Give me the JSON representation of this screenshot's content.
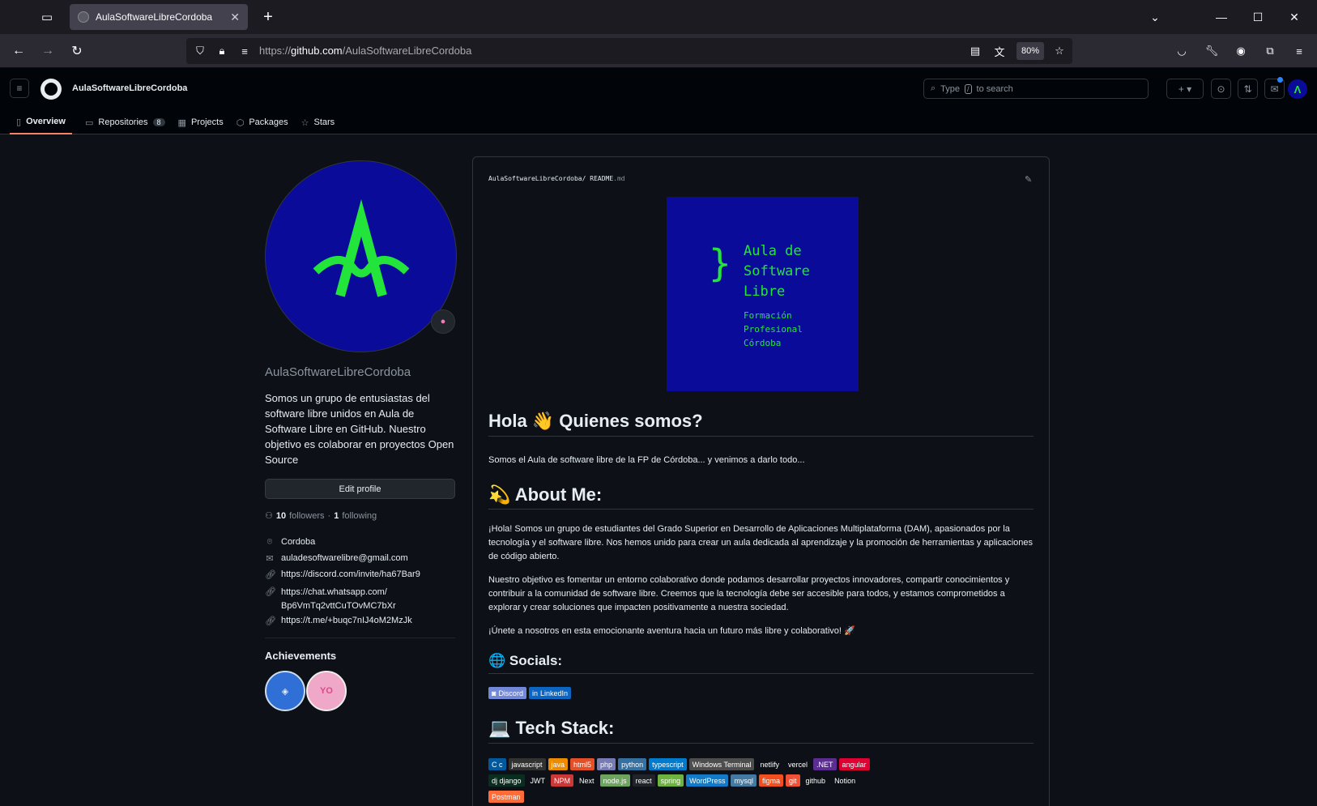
{
  "browser": {
    "tab_title": "AulaSoftwareLibreCordoba",
    "url_prefix": "https://",
    "url_host": "github.com",
    "url_path": "/AulaSoftwareLibreCordoba",
    "zoom": "80%"
  },
  "header": {
    "org_name": "AulaSoftwareLibreCordoba",
    "search_prefix": "Type",
    "search_key": "/",
    "search_suffix": "to search"
  },
  "tabs": [
    {
      "label": "Overview",
      "icon": "book-icon"
    },
    {
      "label": "Repositories",
      "icon": "repo-icon",
      "count": "8"
    },
    {
      "label": "Projects",
      "icon": "table-icon"
    },
    {
      "label": "Packages",
      "icon": "package-icon"
    },
    {
      "label": "Stars",
      "icon": "star-icon"
    }
  ],
  "profile": {
    "avatar_letter": "A",
    "username": "AulaSoftwareLibreCordoba",
    "bio": "Somos un grupo de entusiastas del software libre unidos en Aula de Software Libre en GitHub. Nuestro objetivo es colaborar en proyectos Open Source",
    "edit_label": "Edit profile",
    "followers_count": "10",
    "followers_label": "followers",
    "dot": "·",
    "following_count": "1",
    "following_label": "following",
    "location": "Cordoba",
    "email": "auladesoftwarelibre@gmail.com",
    "link1": "https://discord.com/invite/ha67Bar9",
    "link2_line1": "https://chat.whatsapp.com/",
    "link2_line2": "Bp6VmTq2vttCuTOvMC7bXr",
    "link3": "https://t.me/+buqc7nIJ4oM2MzJk",
    "achievements_title": "Achievements"
  },
  "readme": {
    "path_owner": "AulaSoftwareLibreCordoba",
    "path_sep": "/",
    "path_file": "README",
    "path_ext": ".md",
    "logo_title_1": "Aula de",
    "logo_title_2": "Software",
    "logo_title_3": "Libre",
    "logo_sub_1": "Formación",
    "logo_sub_2": "Profesional",
    "logo_sub_3": "Córdoba",
    "h_hola": "Hola 👋 Quienes somos?",
    "p_intro": "Somos el Aula de software libre de la FP de Córdoba... y venimos a darlo todo...",
    "h_about": "💫 About Me:",
    "p_about1": "¡Hola! Somos un grupo de estudiantes del Grado Superior en Desarrollo de Aplicaciones Multiplataforma (DAM), apasionados por la tecnología y el software libre. Nos hemos unido para crear un aula dedicada al aprendizaje y la promoción de herramientas y aplicaciones de código abierto.",
    "p_about2": "Nuestro objetivo es fomentar un entorno colaborativo donde podamos desarrollar proyectos innovadores, compartir conocimientos y contribuir a la comunidad de software libre. Creemos que la tecnología debe ser accesible para todos, y estamos comprometidos a explorar y crear soluciones que impacten positivamente a nuestra sociedad.",
    "p_about3": "¡Únete a nosotros en esta emocionante aventura hacia un futuro más libre y colaborativo! 🚀",
    "h_socials": "🌐 Socials:",
    "socials": [
      {
        "label": "Discord",
        "color": "#7289da"
      },
      {
        "label": "LinkedIn",
        "color": "#0a66c2"
      }
    ],
    "h_tech": "💻 Tech Stack:",
    "tech_row1": [
      {
        "label": "C  c",
        "color": "#00599c"
      },
      {
        "label": "javascript",
        "color": "#323330"
      },
      {
        "label": "java",
        "color": "#ed8b00"
      },
      {
        "label": "html5",
        "color": "#e34f26"
      },
      {
        "label": "php",
        "color": "#777bb4"
      },
      {
        "label": "python",
        "color": "#3670a0"
      },
      {
        "label": "typescript",
        "color": "#007acc"
      },
      {
        "label": "Windows Terminal",
        "color": "#4d4d4d"
      },
      {
        "label": "netlify",
        "color": "#0d1117"
      },
      {
        "label": "vercel",
        "color": "#0d1117"
      },
      {
        "label": ".NET",
        "color": "#5c2d91"
      },
      {
        "label": "angular",
        "color": "#dd0031"
      }
    ],
    "tech_row2": [
      {
        "label": "dj  django",
        "color": "#092e20"
      },
      {
        "label": "JWT",
        "color": "#0d1117"
      },
      {
        "label": "NPM",
        "color": "#cb3837"
      },
      {
        "label": "Next",
        "color": "#0d1117"
      },
      {
        "label": "node.js",
        "color": "#6da55f"
      },
      {
        "label": "react",
        "color": "#20232a"
      },
      {
        "label": "spring",
        "color": "#6db33f"
      },
      {
        "label": "WordPress",
        "color": "#117ac9"
      },
      {
        "label": "mysql",
        "color": "#4479a1"
      },
      {
        "label": "figma",
        "color": "#f24e1e"
      },
      {
        "label": "git",
        "color": "#f05033"
      },
      {
        "label": "github",
        "color": "#0d1117"
      },
      {
        "label": "Notion",
        "color": "#0d1117"
      }
    ],
    "tech_row3": [
      {
        "label": "Postman",
        "color": "#ff6c37"
      }
    ]
  }
}
